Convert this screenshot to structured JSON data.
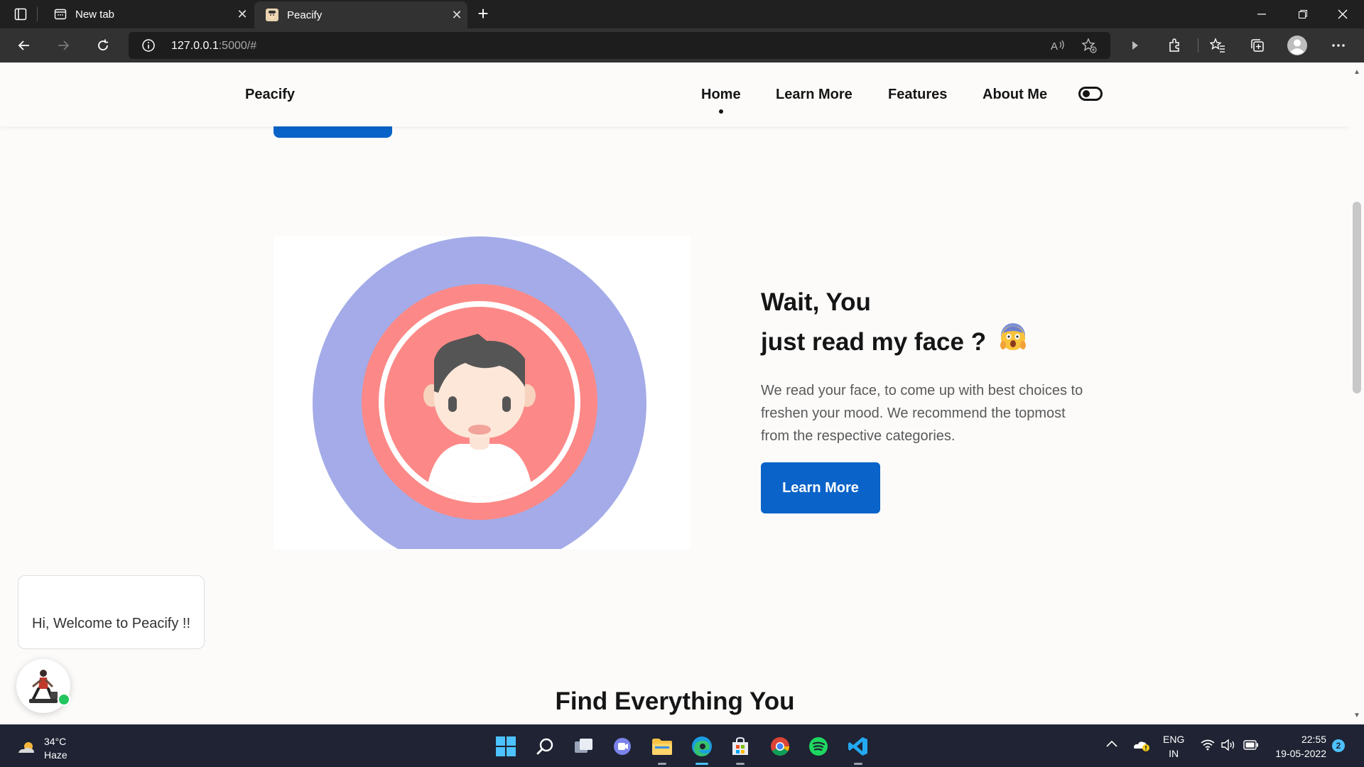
{
  "browser": {
    "tabs": [
      {
        "label": "New tab",
        "active": false
      },
      {
        "label": "Peacify",
        "active": true
      }
    ],
    "address": {
      "host": "127.0.0.1",
      "rest": ":5000/#"
    }
  },
  "nav": {
    "brand": "Peacify",
    "links": [
      "Home",
      "Learn More",
      "Features",
      "About Me"
    ]
  },
  "hero": {
    "title_line1": "Wait, You",
    "title_line2": "just read my face ?",
    "description": "We read your face, to come up with best choices to freshen your mood. We recommend the topmost from the respective categories.",
    "cta_label": "Learn More"
  },
  "chat": {
    "welcome": "Hi, Welcome to Peacify !!"
  },
  "section": {
    "title": "Find Everything You"
  },
  "taskbar": {
    "weather_temp": "34°C",
    "weather_desc": "Haze",
    "lang_top": "ENG",
    "lang_bottom": "IN",
    "time": "22:55",
    "date": "19-05-2022",
    "notifications": "2"
  },
  "colors": {
    "accent": "#0a63c8",
    "page_bg": "#fcfbfa",
    "avatar_outer": "#a4abe8",
    "avatar_inner": "#fc8987"
  }
}
